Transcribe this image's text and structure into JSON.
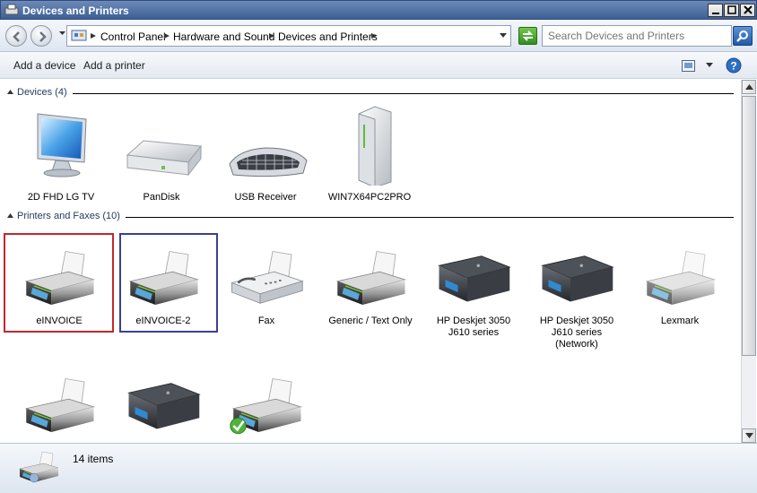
{
  "window": {
    "title": "Devices and Printers"
  },
  "address": {
    "crumbs": [
      "Control Panel",
      "Hardware and Sound",
      "Devices and Printers"
    ],
    "search_placeholder": "Search Devices and Printers"
  },
  "commands": {
    "add_device": "Add a device",
    "add_printer": "Add a printer"
  },
  "groups": {
    "devices": {
      "label": "Devices (4)",
      "items": [
        {
          "name": "2D FHD LG TV",
          "icon": "monitor-icon"
        },
        {
          "name": "PanDisk",
          "icon": "external-drive-icon"
        },
        {
          "name": "USB Receiver",
          "icon": "keyboard-icon"
        },
        {
          "name": "WIN7X64PC2PRO",
          "icon": "computer-tower-icon"
        }
      ]
    },
    "printers": {
      "label": "Printers and Faxes (10)",
      "items": [
        {
          "name": "eINVOICE",
          "icon": "printer-icon"
        },
        {
          "name": "eINVOICE-2",
          "icon": "printer-icon"
        },
        {
          "name": "Fax",
          "icon": "fax-icon"
        },
        {
          "name": "Generic / Text Only",
          "icon": "printer-icon"
        },
        {
          "name": "HP Deskjet 3050 J610 series",
          "icon": "hp-printer-icon"
        },
        {
          "name": "HP Deskjet 3050 J610 series (Network)",
          "icon": "hp-printer-icon"
        },
        {
          "name": "Lexmark",
          "icon": "printer-icon"
        },
        {
          "name": "",
          "icon": "printer-icon"
        },
        {
          "name": "",
          "icon": "hp-printer-icon"
        },
        {
          "name": "",
          "icon": "printer-default-icon"
        }
      ]
    }
  },
  "details": {
    "count": "14 items"
  },
  "colors": {
    "selection_red": "#c4262e",
    "selection_blue": "#3b3e9a",
    "group_header": "#1e395b"
  }
}
